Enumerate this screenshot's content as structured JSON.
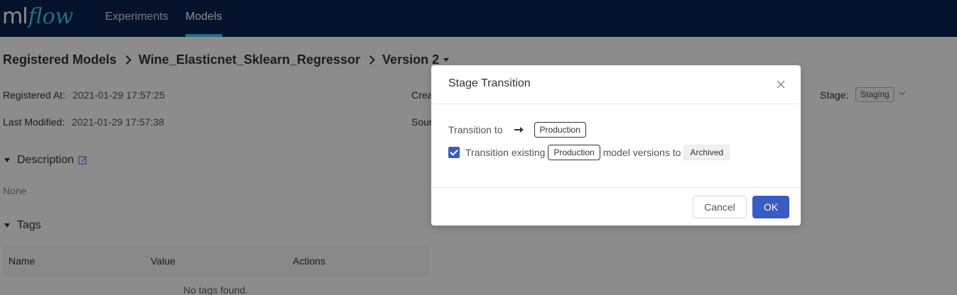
{
  "header": {
    "logo_ml": "ml",
    "logo_flow": "flow",
    "nav": [
      "Experiments",
      "Models"
    ]
  },
  "breadcrumb": {
    "items": [
      "Registered Models",
      "Wine_Elasticnet_Sklearn_Regressor",
      "Version 2"
    ]
  },
  "meta": {
    "registered_at_label": "Registered At",
    "registered_at_value": "2021-01-29 17:57:25",
    "last_modified_label": "Last Modified",
    "last_modified_value": "2021-01-29 17:57:38",
    "created_partial": "Crea",
    "source_partial": "Sour",
    "stage_label": "Stage",
    "stage_value": "Staging"
  },
  "description": {
    "heading": "Description",
    "value": "None"
  },
  "tags": {
    "heading": "Tags",
    "columns": [
      "Name",
      "Value",
      "Actions"
    ],
    "empty_text": "No tags found."
  },
  "modal": {
    "title": "Stage Transition",
    "transition_to_label": "Transition to",
    "target_stage": "Production",
    "checkbox_checked": true,
    "existing_prefix": "Transition existing",
    "existing_stage": "Production",
    "existing_suffix": "model versions to",
    "archive_stage": "Archived",
    "cancel_label": "Cancel",
    "ok_label": "OK"
  },
  "colors": {
    "header_bg": "#082251",
    "logo_flow": "#43c9ed",
    "primary": "#395cc3"
  }
}
